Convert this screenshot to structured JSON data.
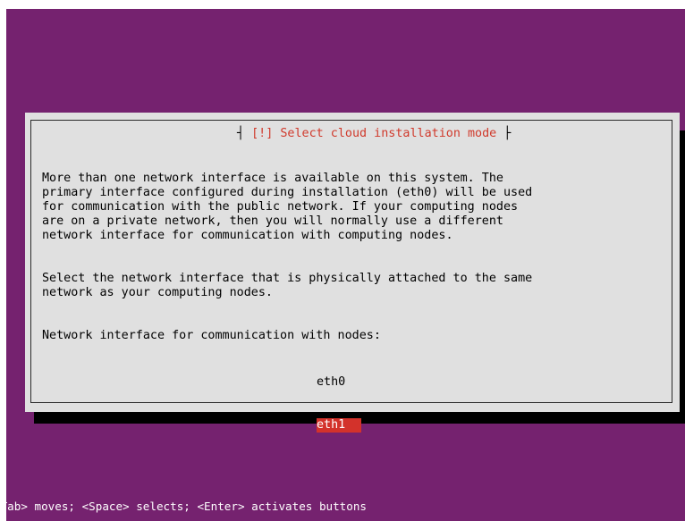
{
  "dialog": {
    "title": "[!] Select cloud installation mode",
    "paragraph1": [
      "More than one network interface is available on this system. The",
      "primary interface configured during installation (eth0) will be used",
      "for communication with the public network. If your computing nodes",
      "are on a private network, then you will normally use a different",
      "network interface for communication with computing nodes."
    ],
    "paragraph2": [
      "Select the network interface that is physically attached to the same",
      "network as your computing nodes."
    ],
    "prompt": "Network interface for communication with nodes:",
    "options": [
      {
        "label": "eth0",
        "selected": false
      },
      {
        "label": "eth1",
        "selected": true
      }
    ]
  },
  "help_line": "<Tab> moves; <Space> selects; <Enter> activates buttons",
  "colors": {
    "background": "#75226f",
    "dialog": "#e0e0e0",
    "title": "#d0392b",
    "selection": "#d3322b",
    "shadow": "#000000"
  }
}
